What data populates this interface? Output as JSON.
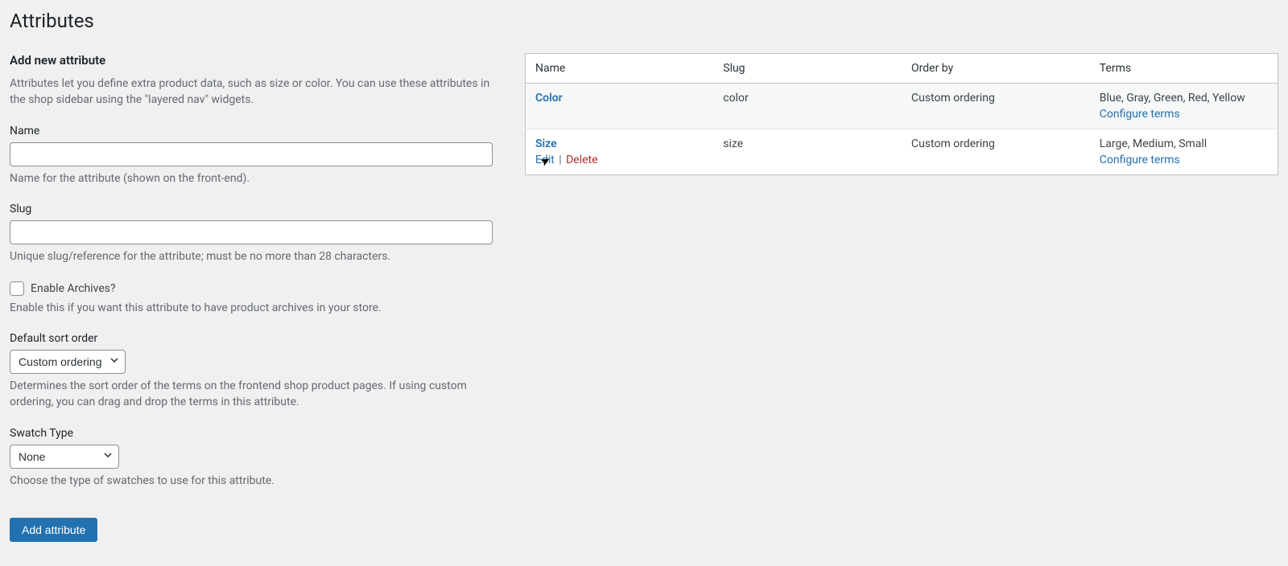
{
  "page_title": "Attributes",
  "form": {
    "title": "Add new attribute",
    "intro": "Attributes let you define extra product data, such as size or color. You can use these attributes in the shop sidebar using the \"layered nav\" widgets.",
    "name": {
      "label": "Name",
      "value": "",
      "hint": "Name for the attribute (shown on the front-end)."
    },
    "slug": {
      "label": "Slug",
      "value": "",
      "hint": "Unique slug/reference for the attribute; must be no more than 28 characters."
    },
    "archives": {
      "label": "Enable Archives?",
      "hint": "Enable this if you want this attribute to have product archives in your store."
    },
    "sort": {
      "label": "Default sort order",
      "value": "Custom ordering",
      "hint": "Determines the sort order of the terms on the frontend shop product pages. If using custom ordering, you can drag and drop the terms in this attribute."
    },
    "swatch": {
      "label": "Swatch Type",
      "value": "None",
      "hint": "Choose the type of swatches to use for this attribute."
    },
    "submit": "Add attribute"
  },
  "table": {
    "headers": {
      "name": "Name",
      "slug": "Slug",
      "order": "Order by",
      "terms": "Terms"
    },
    "configure": "Configure terms",
    "actions": {
      "edit": "Edit",
      "delete": "Delete"
    },
    "rows": [
      {
        "name": "Color",
        "slug": "color",
        "order": "Custom ordering",
        "terms": "Blue, Gray, Green, Red, Yellow",
        "show_actions": false
      },
      {
        "name": "Size",
        "slug": "size",
        "order": "Custom ordering",
        "terms": "Large, Medium, Small",
        "show_actions": true
      }
    ]
  }
}
